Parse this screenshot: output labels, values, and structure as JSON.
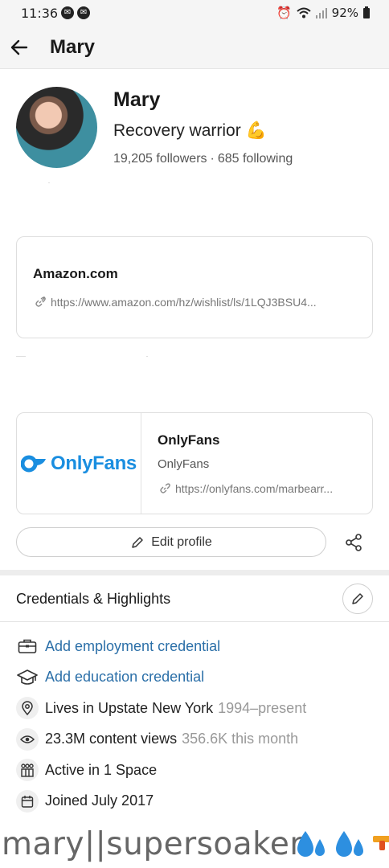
{
  "status_bar": {
    "time": "11:36",
    "battery": "92%"
  },
  "header": {
    "title": "Mary"
  },
  "profile": {
    "name": "Mary",
    "bio": "Recovery warrior 💪",
    "followers": "19,205 followers",
    "following": "685 following"
  },
  "links": [
    {
      "title": "Amazon.com",
      "url": "https://www.amazon.com/hz/wishlist/ls/1LQJ3BSU4..."
    },
    {
      "logo_text": "OnlyFans",
      "title": "OnlyFans",
      "subtitle": "OnlyFans",
      "url": "https://onlyfans.com/marbearr..."
    }
  ],
  "actions": {
    "edit_label": "Edit profile"
  },
  "credentials": {
    "title": "Credentials & Highlights",
    "items": [
      {
        "icon": "briefcase-icon",
        "text": "Add employment credential",
        "extra": ""
      },
      {
        "icon": "graduation-cap-icon",
        "text": "Add education credential",
        "extra": ""
      },
      {
        "icon": "location-pin-icon",
        "text": "Lives in Upstate New York",
        "extra": "1994–present"
      },
      {
        "icon": "eye-icon",
        "text": "23.3M content views",
        "extra": "356.6K this month"
      },
      {
        "icon": "spaces-icon",
        "text": "Active in 1 Space",
        "extra": ""
      },
      {
        "icon": "calendar-icon",
        "text": "Joined July 2017",
        "extra": ""
      }
    ]
  },
  "footer": {
    "text": "mary||supersoaker"
  },
  "colors": {
    "link_blue": "#2b6fa8",
    "onlyfans_blue": "#1a8ee0"
  }
}
